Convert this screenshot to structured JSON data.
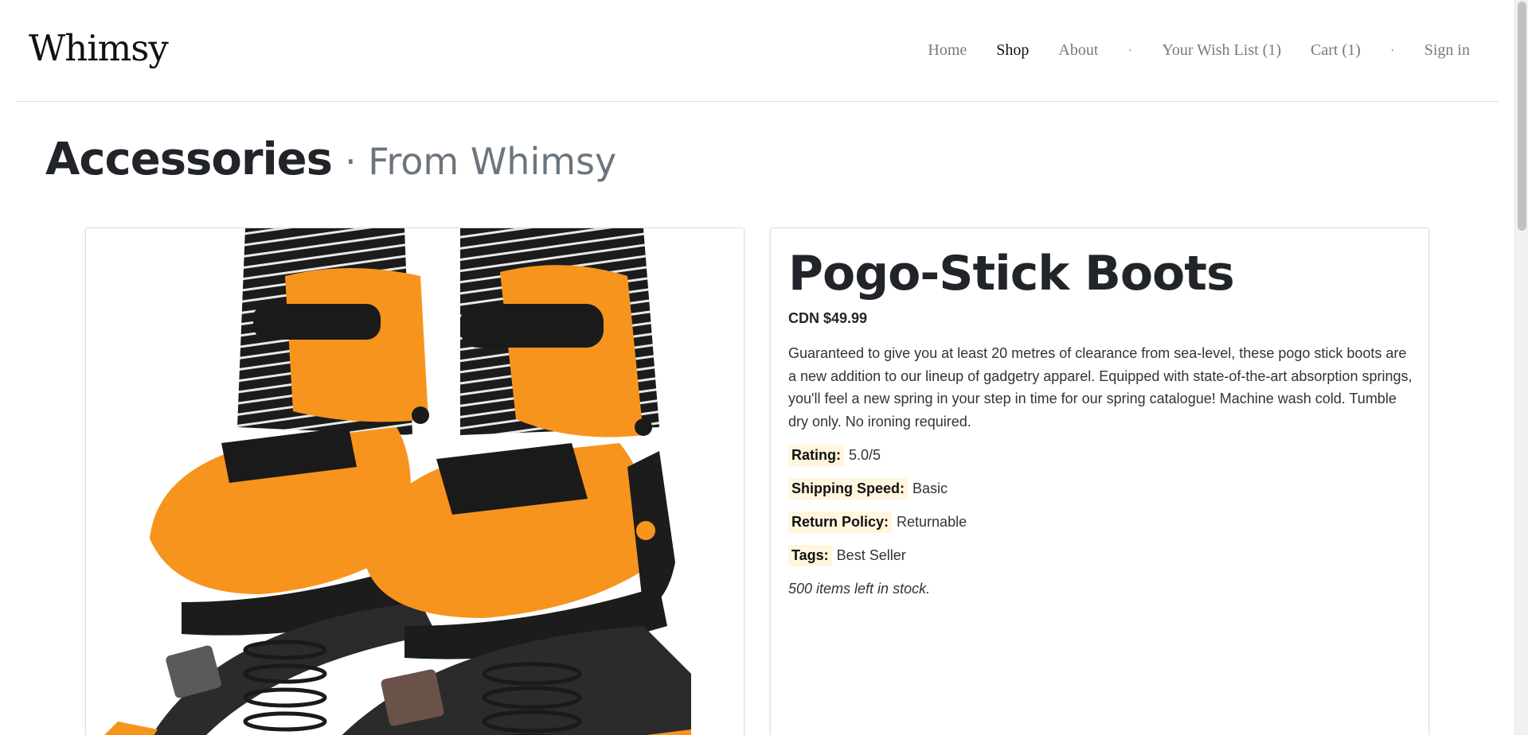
{
  "brand": "Whimsy",
  "nav": [
    {
      "label": "Home",
      "active": false
    },
    {
      "label": "Shop",
      "active": true
    },
    {
      "label": "About",
      "active": false
    },
    {
      "label": "·",
      "separator": true
    },
    {
      "label": "Your Wish List (1)",
      "active": false
    },
    {
      "label": "Cart (1)",
      "active": false
    },
    {
      "label": "·",
      "separator": true
    },
    {
      "label": "Sign in",
      "active": false
    }
  ],
  "page": {
    "title": "Accessories",
    "subtitle": "· From Whimsy"
  },
  "product": {
    "image_alt": "Pogo-Stick Boots",
    "title": "Pogo-Stick Boots",
    "price": "CDN $49.99",
    "description": "Guaranteed to give you at least 20 metres of clearance from sea-level, these pogo stick boots are a new addition to our lineup of gadgetry apparel. Equipped with state-of-the-art absorption springs, you'll feel a new spring in your step in time for our spring catalogue! Machine wash cold. Tumble dry only. No ironing required.",
    "details": [
      {
        "label": "Rating:",
        "value": "5.0/5"
      },
      {
        "label": "Shipping Speed:",
        "value": "Basic"
      },
      {
        "label": "Return Policy:",
        "value": "Returnable"
      },
      {
        "label": "Tags:",
        "value": "Best Seller"
      }
    ],
    "stock": "500 items left in stock."
  },
  "colors": {
    "boot_orange": "#f7941d",
    "boot_black": "#1c1c1c",
    "label_highlight": "#fff6dd"
  }
}
